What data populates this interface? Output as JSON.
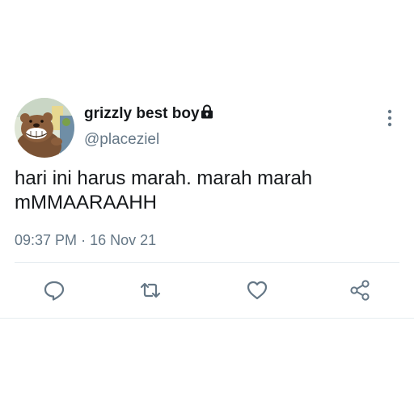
{
  "user": {
    "display_name": "grizzly best boy",
    "handle": "@placeziel",
    "protected_icon": "lock-icon",
    "avatar": "grizzly-bear-avatar"
  },
  "tweet": {
    "lines": [
      "hari ini harus marah. marah marah",
      "mMMAARAAHH"
    ],
    "time": "09:37 PM",
    "separator": "·",
    "date": "16 Nov 21"
  },
  "actions": {
    "reply_icon": "comment-icon",
    "retweet_icon": "retweet-icon",
    "like_icon": "heart-icon",
    "share_icon": "share-icon",
    "more_icon": "more-vertical-icon"
  },
  "colors": {
    "text": "#14171a",
    "secondary": "#657786",
    "divider": "#e6ecf0"
  }
}
